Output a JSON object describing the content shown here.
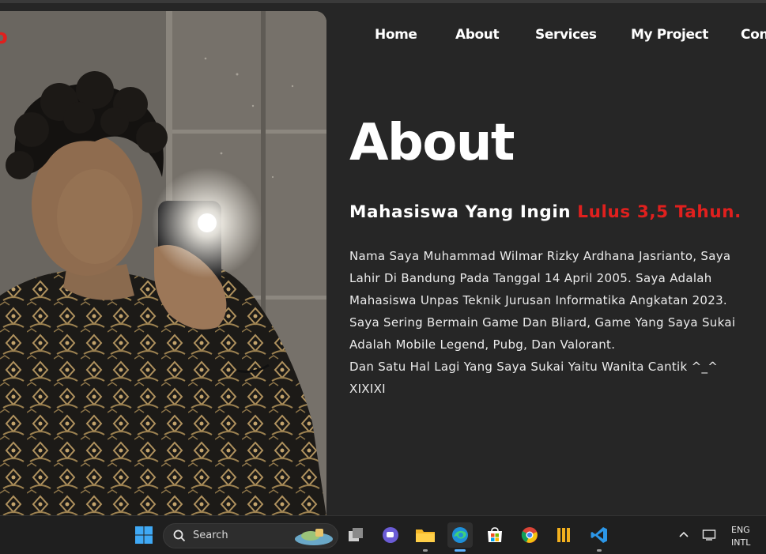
{
  "logo": {
    "visible_text": "o"
  },
  "nav": {
    "items": [
      {
        "label": "Home"
      },
      {
        "label": "About"
      },
      {
        "label": "Services"
      },
      {
        "label": "My Project"
      },
      {
        "label": "Con"
      }
    ]
  },
  "about": {
    "title": "About",
    "subtitle_main": "Mahasiswa Yang Ingin ",
    "subtitle_accent": "Lulus 3,5 Tahun.",
    "bio_lines": [
      "Nama Saya Muhammad Wilmar Rizky Ardhana Jasrianto, Saya",
      "Lahir Di Bandung Pada Tanggal 14 April 2005. Saya Adalah",
      "Mahasiswa Unpas Teknik Jurusan Informatika Angkatan 2023.",
      "Saya Sering Bermain Game Dan Bliard, Game Yang Saya Sukai",
      "Adalah Mobile Legend, Pubg, Dan Valorant.",
      "Dan Satu Hal Lagi Yang Saya Sukai Yaitu Wanita Cantik ^_^",
      "XIXIXI"
    ]
  },
  "colors": {
    "accent": "#e0201e",
    "background": "#262626",
    "text": "#ffffff"
  },
  "taskbar": {
    "search_label": "Search",
    "apps": [
      "start-icon",
      "search-icon",
      "task-view-icon",
      "chat-icon",
      "file-explorer-icon",
      "edge-icon",
      "store-icon",
      "chrome-icon",
      "library-app-icon",
      "vscode-icon"
    ],
    "tray": {
      "lang_line1": "ENG",
      "lang_line2": "INTL"
    }
  }
}
